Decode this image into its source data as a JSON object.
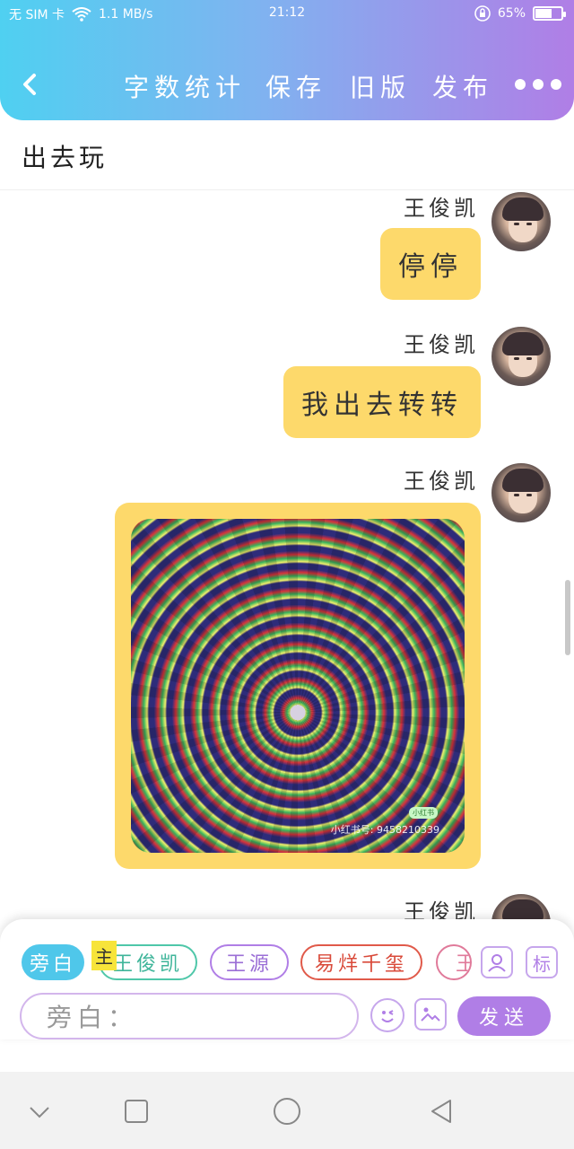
{
  "status_bar": {
    "carrier": "无 SIM 卡",
    "network_speed": "1.1 MB/s",
    "time": "21:12",
    "battery": "65%",
    "battery_level": 0.65
  },
  "toolbar": {
    "word_count": "字数统计",
    "save": "保存",
    "old_version": "旧版",
    "publish": "发布"
  },
  "story_title": "出去玩",
  "messages": [
    {
      "sender": "王俊凯",
      "text": "停停"
    },
    {
      "sender": "王俊凯",
      "text": "我出去转转"
    },
    {
      "sender": "王俊凯",
      "image_watermark": "小红书号: 9458210339",
      "image_badge": "小红书"
    },
    {
      "sender": "王俊凯"
    }
  ],
  "characters": {
    "narrator": "旁白",
    "host_tag": "主",
    "wjk": "王俊凯",
    "wy": "王源",
    "yyqx": "易烊千玺",
    "cut": "王"
  },
  "input": {
    "placeholder": "旁白：",
    "send": "发送",
    "label_icon": "标"
  },
  "icons": {
    "back": "chevron-left",
    "more": "ellipsis",
    "emoji": "smiley",
    "image": "image",
    "profile": "person-card",
    "nav_down": "chevron-down",
    "nav_home": "circle",
    "nav_recent": "square",
    "nav_back": "triangle-left"
  },
  "colors": {
    "bubble": "#fdd96b",
    "accent_purple": "#b07ee6",
    "accent_cyan": "#4fc7ea"
  }
}
